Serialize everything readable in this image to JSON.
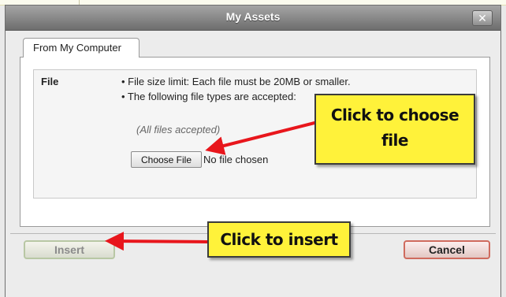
{
  "dialog": {
    "title": "My Assets",
    "close_glyph": "✕"
  },
  "tabs": [
    {
      "label": "From My Computer"
    }
  ],
  "upload": {
    "field_label": "File",
    "rules": [
      "• File size limit: Each file must be 20MB or smaller.",
      "• The following file types are accepted:"
    ],
    "accepted_types": "(All files accepted)",
    "choose_button_label": "Choose File",
    "no_file_text": "No file chosen"
  },
  "footer": {
    "insert_label": "Insert",
    "cancel_label": "Cancel"
  },
  "annotations": {
    "choose_callout_line1": "Click to choose",
    "choose_callout_line2": "file",
    "insert_callout": "Click to insert",
    "arrow_color": "#e8161c",
    "callout_color": "#fff23a"
  }
}
